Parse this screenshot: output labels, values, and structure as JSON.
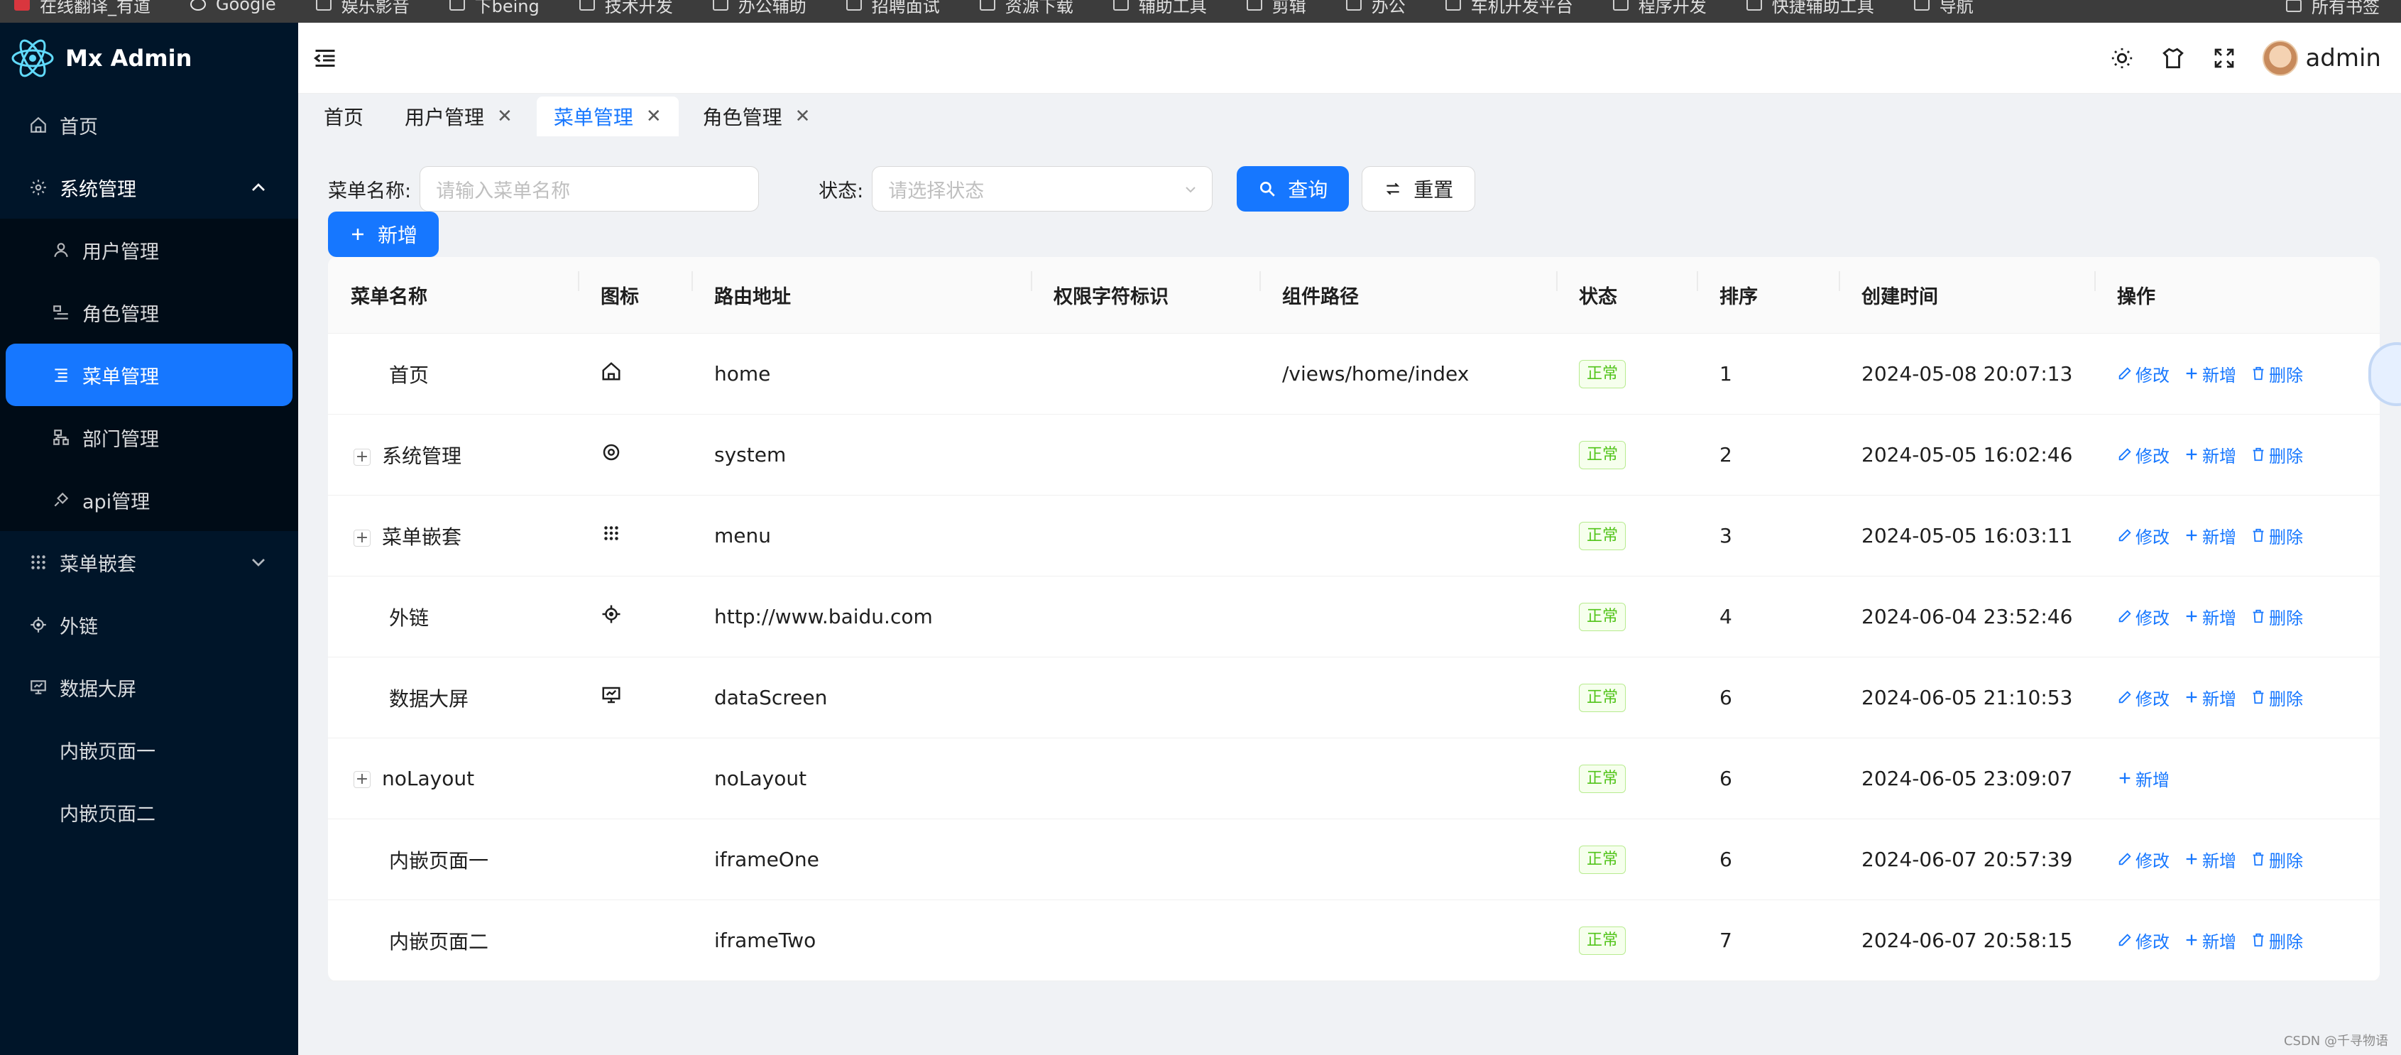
{
  "bookmarks": [
    "在线翻译_有道",
    "Google",
    "娱乐影音",
    "下being",
    "技术开发",
    "办公辅助",
    "招聘面试",
    "资源下载",
    "辅助工具",
    "剪辑",
    "办公",
    "车机开发平台",
    "程序开发",
    "快捷辅助工具",
    "导航"
  ],
  "bookmarks_right": "所有书签",
  "app": {
    "title": "Mx Admin"
  },
  "sidebar": {
    "home": "首页",
    "system": "系统管理",
    "system_children": [
      "用户管理",
      "角色管理",
      "菜单管理",
      "部门管理",
      "api管理"
    ],
    "nested": "菜单嵌套",
    "external": "外链",
    "datascreen": "数据大屏",
    "iframe1": "内嵌页面一",
    "iframe2": "内嵌页面二"
  },
  "header": {
    "username": "admin"
  },
  "tabs": [
    {
      "label": "首页",
      "closable": false
    },
    {
      "label": "用户管理",
      "closable": true
    },
    {
      "label": "菜单管理",
      "closable": true,
      "active": true
    },
    {
      "label": "角色管理",
      "closable": true
    }
  ],
  "search": {
    "name_label": "菜单名称:",
    "name_placeholder": "请输入菜单名称",
    "status_label": "状态:",
    "status_placeholder": "请选择状态",
    "query_label": "查询",
    "reset_label": "重置",
    "add_label": "新增"
  },
  "table": {
    "columns": [
      "菜单名称",
      "图标",
      "路由地址",
      "权限字符标识",
      "组件路径",
      "状态",
      "排序",
      "创建时间",
      "操作"
    ],
    "rows": [
      {
        "name": "首页",
        "expandable": false,
        "icon": "home-icon",
        "path": "home",
        "perm": "",
        "component": "/views/home/index",
        "status": "正常",
        "sort": "1",
        "created": "2024-05-08 20:07:13",
        "ops": [
          "修改",
          "新增",
          "删除"
        ]
      },
      {
        "name": "系统管理",
        "expandable": true,
        "icon": "gear-icon",
        "path": "system",
        "perm": "",
        "component": "",
        "status": "正常",
        "sort": "2",
        "created": "2024-05-05 16:02:46",
        "ops": [
          "修改",
          "新增",
          "删除"
        ]
      },
      {
        "name": "菜单嵌套",
        "expandable": true,
        "icon": "grid-icon",
        "path": "menu",
        "perm": "",
        "component": "",
        "status": "正常",
        "sort": "3",
        "created": "2024-05-05 16:03:11",
        "ops": [
          "修改",
          "新增",
          "删除"
        ]
      },
      {
        "name": "外链",
        "expandable": false,
        "icon": "aim-icon",
        "path": "http://www.baidu.com",
        "perm": "",
        "component": "",
        "status": "正常",
        "sort": "4",
        "created": "2024-06-04 23:52:46",
        "ops": [
          "修改",
          "新增",
          "删除"
        ]
      },
      {
        "name": "数据大屏",
        "expandable": false,
        "icon": "monitor-icon",
        "path": "dataScreen",
        "perm": "",
        "component": "",
        "status": "正常",
        "sort": "6",
        "created": "2024-06-05 21:10:53",
        "ops": [
          "修改",
          "新增",
          "删除"
        ]
      },
      {
        "name": "noLayout",
        "expandable": true,
        "icon": "",
        "path": "noLayout",
        "perm": "",
        "component": "",
        "status": "正常",
        "sort": "6",
        "created": "2024-06-05 23:09:07",
        "ops": [
          "新增"
        ]
      },
      {
        "name": "内嵌页面一",
        "expandable": false,
        "icon": "",
        "path": "iframeOne",
        "perm": "",
        "component": "",
        "status": "正常",
        "sort": "6",
        "created": "2024-06-07 20:57:39",
        "ops": [
          "修改",
          "新增",
          "删除"
        ]
      },
      {
        "name": "内嵌页面二",
        "expandable": false,
        "icon": "",
        "path": "iframeTwo",
        "perm": "",
        "component": "",
        "status": "正常",
        "sort": "7",
        "created": "2024-06-07 20:58:15",
        "ops": [
          "修改",
          "新增",
          "删除"
        ]
      }
    ]
  },
  "colors": {
    "primary": "#1677ff",
    "sidebar": "#001529",
    "success": "#52c41a"
  },
  "watermark": "CSDN @千寻物语"
}
